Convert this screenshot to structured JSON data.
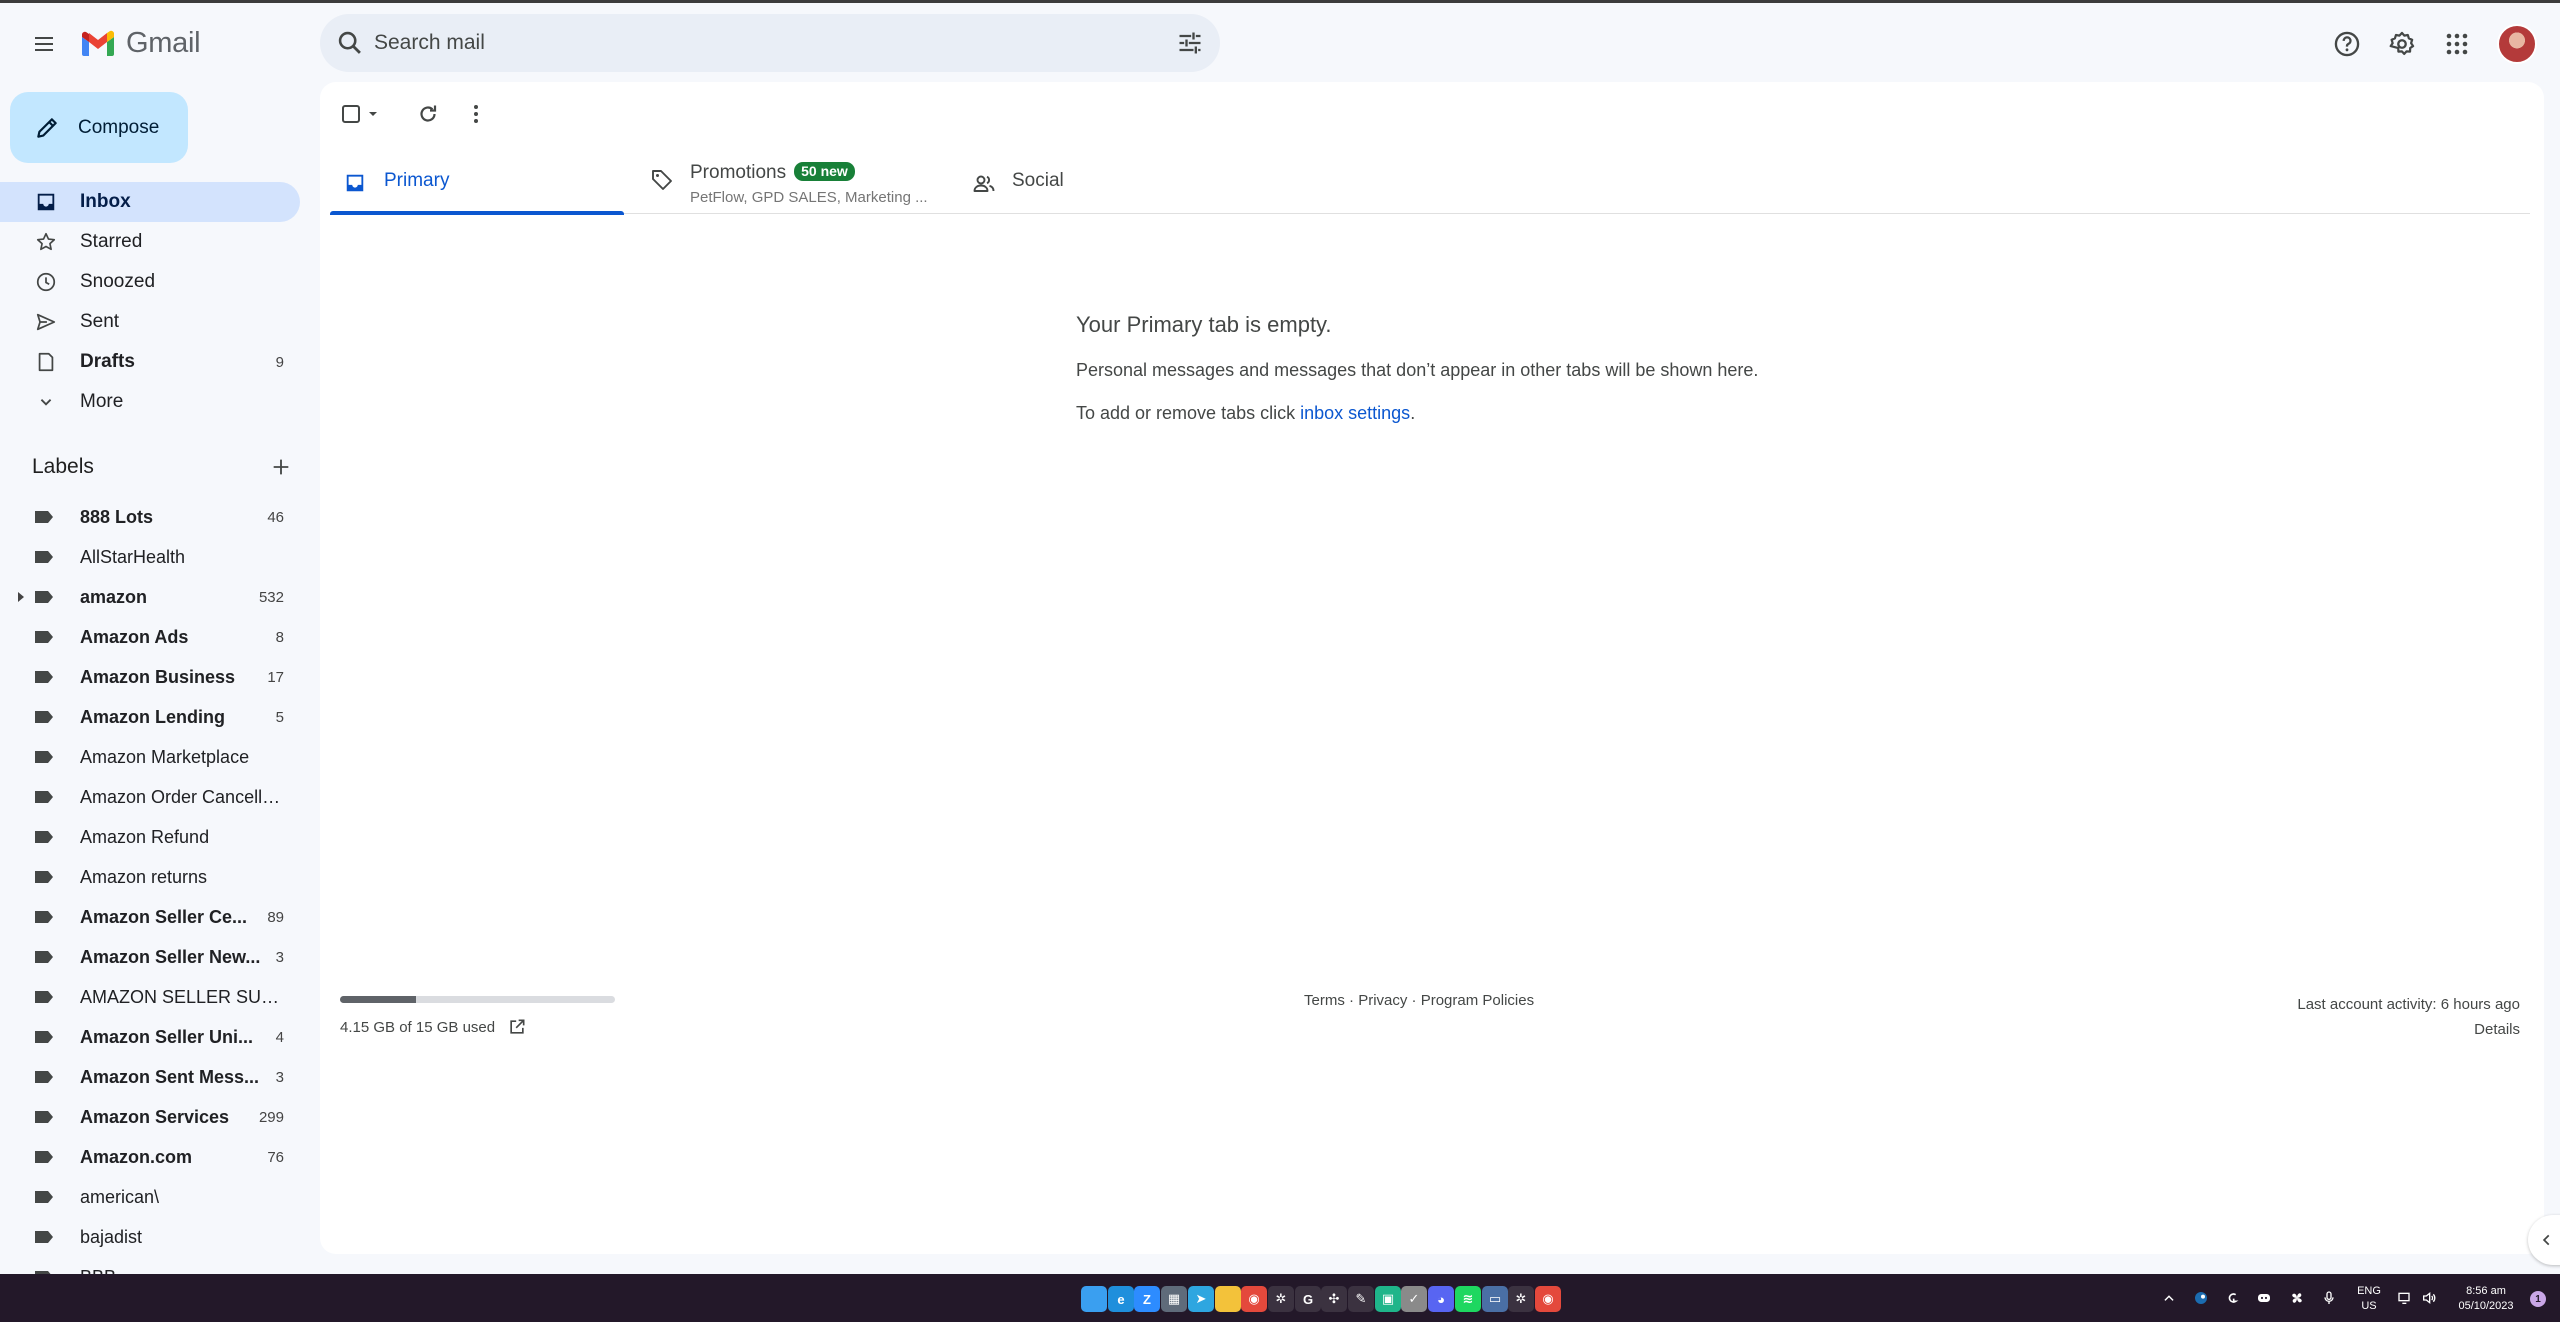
{
  "app": {
    "name": "Gmail"
  },
  "search": {
    "placeholder": "Search mail"
  },
  "compose": {
    "label": "Compose"
  },
  "nav": [
    {
      "label": "Inbox",
      "count": "",
      "icon": "inbox-icon"
    },
    {
      "label": "Starred",
      "count": "",
      "icon": "star-icon"
    },
    {
      "label": "Snoozed",
      "count": "",
      "icon": "clock-icon"
    },
    {
      "label": "Sent",
      "count": "",
      "icon": "send-icon"
    },
    {
      "label": "Drafts",
      "count": "9",
      "icon": "draft-icon"
    },
    {
      "label": "More",
      "count": "",
      "icon": "chevron-down-icon"
    }
  ],
  "labels_header": "Labels",
  "labels": [
    {
      "name": "888 Lots",
      "count": "46",
      "bold": true
    },
    {
      "name": "AllStarHealth",
      "count": "",
      "bold": false
    },
    {
      "name": "amazon",
      "count": "532",
      "bold": true
    },
    {
      "name": "Amazon Ads",
      "count": "8",
      "bold": true
    },
    {
      "name": "Amazon Business",
      "count": "17",
      "bold": true
    },
    {
      "name": "Amazon Lending",
      "count": "5",
      "bold": true
    },
    {
      "name": "Amazon Marketplace",
      "count": "",
      "bold": false
    },
    {
      "name": "Amazon Order Cancella...",
      "count": "",
      "bold": false
    },
    {
      "name": "Amazon Refund",
      "count": "",
      "bold": false
    },
    {
      "name": "Amazon returns",
      "count": "",
      "bold": false
    },
    {
      "name": "Amazon Seller Ce...",
      "count": "89",
      "bold": true
    },
    {
      "name": "Amazon Seller New...",
      "count": "3",
      "bold": true
    },
    {
      "name": "AMAZON SELLER SUPP...",
      "count": "",
      "bold": false
    },
    {
      "name": "Amazon Seller Uni...",
      "count": "4",
      "bold": true
    },
    {
      "name": "Amazon Sent Mess...",
      "count": "3",
      "bold": true
    },
    {
      "name": "Amazon Services",
      "count": "299",
      "bold": true
    },
    {
      "name": "Amazon.com",
      "count": "76",
      "bold": true
    },
    {
      "name": "american\\",
      "count": "",
      "bold": false
    },
    {
      "name": "bajadist",
      "count": "",
      "bold": false
    },
    {
      "name": "BBB",
      "count": "",
      "bold": false
    }
  ],
  "tabs": {
    "primary": {
      "label": "Primary"
    },
    "promotions": {
      "label": "Promotions",
      "badge": "50 new",
      "subtitle": "PetFlow, GPD SALES, Marketing ..."
    },
    "social": {
      "label": "Social"
    }
  },
  "empty_state": {
    "title": "Your Primary tab is empty.",
    "line1": "Personal messages and messages that don’t appear in other tabs will be shown here.",
    "line2_prefix": "To add or remove tabs click ",
    "line2_link": "inbox settings",
    "line2_suffix": "."
  },
  "footer": {
    "storage_text": "4.15 GB of 15 GB used",
    "storage_fraction": 0.277,
    "terms": "Terms",
    "sep1": " · ",
    "privacy": "Privacy",
    "sep2": " · ",
    "policies": "Program Policies",
    "last_activity": "Last account activity: 6 hours ago",
    "details": "Details"
  },
  "taskbar": {
    "apps": [
      {
        "name": "windows-start-icon",
        "color": "#3a9ff0",
        "glyph": ""
      },
      {
        "name": "edge-icon",
        "color": "#1f8fdc",
        "glyph": "e"
      },
      {
        "name": "zoom-icon",
        "color": "#2d8cff",
        "glyph": "Z"
      },
      {
        "name": "calculator-icon",
        "color": "#5f6b7a",
        "glyph": "▦"
      },
      {
        "name": "telegram-icon",
        "color": "#2ea6e0",
        "glyph": "➤"
      },
      {
        "name": "file-explorer-icon",
        "color": "#f3c23a",
        "glyph": ""
      },
      {
        "name": "chrome-icon",
        "color": "#e4493c",
        "glyph": "◉"
      },
      {
        "name": "settings-app-icon",
        "color": "#3b3240",
        "glyph": "✲"
      },
      {
        "name": "logitech-icon",
        "color": "#3b3240",
        "glyph": "G"
      },
      {
        "name": "fan-app-icon",
        "color": "#3b3240",
        "glyph": "✣"
      },
      {
        "name": "quill-icon",
        "color": "#3b3240",
        "glyph": "✎"
      },
      {
        "name": "green-app-icon",
        "color": "#1fb58a",
        "glyph": "▣"
      },
      {
        "name": "checkbox-app-icon",
        "color": "#8a8a8a",
        "glyph": "✓"
      },
      {
        "name": "discord-icon",
        "color": "#5865f2",
        "glyph": "◕"
      },
      {
        "name": "spotify-icon",
        "color": "#1ed760",
        "glyph": "≋"
      },
      {
        "name": "remote-desktop-icon",
        "color": "#4a6fa5",
        "glyph": "▭"
      },
      {
        "name": "steelseries-icon",
        "color": "#3b3240",
        "glyph": "✲"
      },
      {
        "name": "chrome-profile-icon",
        "color": "#e4493c",
        "glyph": "◉"
      }
    ],
    "lang_line1": "ENG",
    "lang_line2": "US",
    "time": "8:56 am",
    "date": "05/10/2023",
    "notif_count": "1"
  }
}
